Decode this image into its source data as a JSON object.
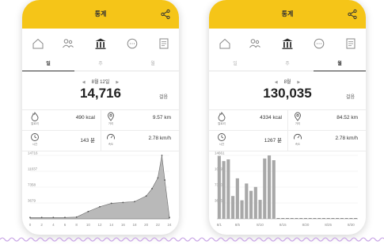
{
  "colors": {
    "accent": "#f5c518",
    "bar": "#a8a8a8",
    "area": "#b9b9b9",
    "wave": "#c8a2e6"
  },
  "screens": [
    {
      "title": "통계",
      "nav_icons": [
        "home-icon",
        "people-icon",
        "stats-icon",
        "chat-icon",
        "notes-icon"
      ],
      "tabs": [
        {
          "label": "일",
          "active": true
        },
        {
          "label": "주",
          "active": false
        },
        {
          "label": "월",
          "active": false
        }
      ],
      "date": "8월 12일",
      "big_value": "14,716",
      "unit": "걸음",
      "stats": {
        "calories": {
          "caption": "칼로리",
          "value": "490 kcal"
        },
        "distance": {
          "caption": "거리",
          "value": "9.57 km"
        },
        "time": {
          "caption": "시간",
          "value": "143 분"
        },
        "speed": {
          "caption": "속도",
          "value": "2.78 km/h"
        }
      },
      "chart_data": {
        "type": "area",
        "x": [
          0,
          2,
          4,
          6,
          8,
          10,
          12,
          14,
          16,
          18,
          20,
          21,
          22,
          22.7,
          23.2,
          24
        ],
        "values": [
          320,
          320,
          320,
          320,
          400,
          1700,
          2800,
          3600,
          3800,
          4000,
          5300,
          7000,
          9500,
          14716,
          9000,
          320
        ],
        "xticks": [
          "0",
          "2",
          "4",
          "6",
          "8",
          "10",
          "12",
          "14",
          "16",
          "18",
          "20",
          "22",
          "24"
        ],
        "xlim": [
          0,
          24
        ],
        "ylim": [
          0,
          14716
        ],
        "yticks": [
          "14716",
          "11037",
          "7358",
          "3679"
        ]
      }
    },
    {
      "title": "통계",
      "nav_icons": [
        "home-icon",
        "people-icon",
        "stats-icon",
        "chat-icon",
        "notes-icon"
      ],
      "tabs": [
        {
          "label": "일",
          "active": false
        },
        {
          "label": "주",
          "active": false
        },
        {
          "label": "월",
          "active": true
        }
      ],
      "date": "8월",
      "big_value": "130,035",
      "unit": "걸음",
      "stats": {
        "calories": {
          "caption": "칼로리",
          "value": "4334 kcal"
        },
        "distance": {
          "caption": "거리",
          "value": "84.52 km"
        },
        "time": {
          "caption": "시간",
          "value": "1267 분"
        },
        "speed": {
          "caption": "속도",
          "value": "2.78 km/h"
        }
      },
      "chart_data": {
        "type": "bar",
        "categories": [
          "8/1",
          "8/2",
          "8/3",
          "8/4",
          "8/5",
          "8/6",
          "8/7",
          "8/8",
          "8/9",
          "8/10",
          "8/11",
          "8/12",
          "8/13",
          "8/14",
          "8/15",
          "8/16",
          "8/17",
          "8/18",
          "8/19",
          "8/20",
          "8/21",
          "8/22",
          "8/23",
          "8/24",
          "8/25",
          "8/26",
          "8/27",
          "8/28",
          "8/29",
          "8/30",
          "8/31"
        ],
        "values": [
          14600,
          13400,
          13800,
          5300,
          9400,
          4300,
          8200,
          6500,
          7400,
          4400,
          14000,
          14716,
          13600,
          0,
          0,
          0,
          0,
          0,
          0,
          0,
          0,
          0,
          0,
          0,
          0,
          0,
          0,
          0,
          0,
          0,
          0
        ],
        "xticks": [
          "8/1",
          "8/5",
          "8/10",
          "8/15",
          "8/20",
          "8/25",
          "8/30"
        ],
        "ylim": [
          0,
          14716
        ],
        "yticks": [
          "14661",
          "10996",
          "7330",
          "3665"
        ]
      }
    }
  ]
}
